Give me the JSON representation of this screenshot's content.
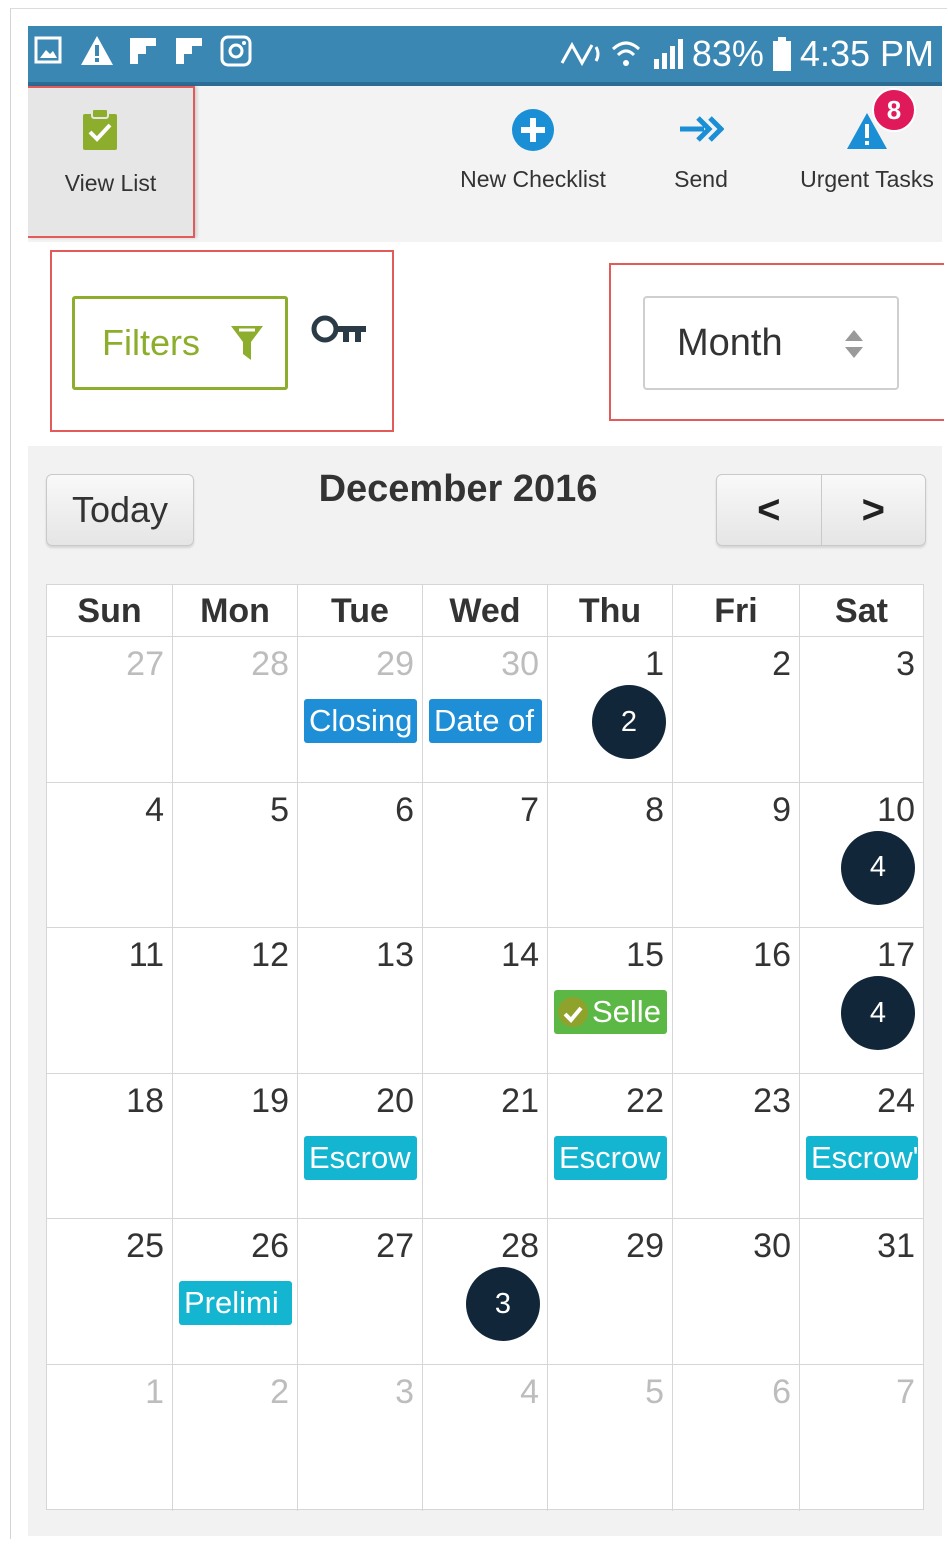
{
  "status_bar": {
    "battery": "83%",
    "time": "4:35 PM"
  },
  "toolbar": {
    "view_list": "View List",
    "new_checklist": "New Checklist",
    "send": "Send",
    "urgent_tasks": "Urgent Tasks",
    "urgent_count": "8"
  },
  "filters": {
    "label": "Filters"
  },
  "view_select": {
    "value": "Month"
  },
  "calendar": {
    "today_label": "Today",
    "title": "December 2016",
    "prev_label": "<",
    "next_label": ">",
    "weekdays": [
      "Sun",
      "Mon",
      "Tue",
      "Wed",
      "Thu",
      "Fri",
      "Sat"
    ],
    "weeks": [
      [
        {
          "day": "27",
          "other": true
        },
        {
          "day": "28",
          "other": true
        },
        {
          "day": "29",
          "other": true,
          "event": "Closing",
          "event_color": "blue"
        },
        {
          "day": "30",
          "other": true,
          "event": "Date of",
          "event_color": "blue"
        },
        {
          "day": "1",
          "count": "2"
        },
        {
          "day": "2"
        },
        {
          "day": "3"
        }
      ],
      [
        {
          "day": "4"
        },
        {
          "day": "5"
        },
        {
          "day": "6"
        },
        {
          "day": "7"
        },
        {
          "day": "8"
        },
        {
          "day": "9"
        },
        {
          "day": "10",
          "count": "4"
        }
      ],
      [
        {
          "day": "11"
        },
        {
          "day": "12"
        },
        {
          "day": "13"
        },
        {
          "day": "14"
        },
        {
          "day": "15",
          "event": "Selle",
          "event_color": "green",
          "completed": true
        },
        {
          "day": "16"
        },
        {
          "day": "17",
          "count": "4"
        }
      ],
      [
        {
          "day": "18"
        },
        {
          "day": "19"
        },
        {
          "day": "20",
          "event": "Escrow",
          "event_color": "cyan"
        },
        {
          "day": "21"
        },
        {
          "day": "22",
          "event": "Escrow",
          "event_color": "cyan"
        },
        {
          "day": "23"
        },
        {
          "day": "24",
          "event": "Escrow'",
          "event_color": "cyan"
        }
      ],
      [
        {
          "day": "25"
        },
        {
          "day": "26",
          "event": "Prelimi",
          "event_color": "cyan"
        },
        {
          "day": "27"
        },
        {
          "day": "28",
          "count": "3"
        },
        {
          "day": "29"
        },
        {
          "day": "30"
        },
        {
          "day": "31"
        }
      ],
      [
        {
          "day": "1",
          "other": true
        },
        {
          "day": "2",
          "other": true
        },
        {
          "day": "3",
          "other": true
        },
        {
          "day": "4",
          "other": true
        },
        {
          "day": "5",
          "other": true
        },
        {
          "day": "6",
          "other": true
        },
        {
          "day": "7",
          "other": true
        }
      ]
    ]
  },
  "colors": {
    "status_bar": "#3a87b4",
    "accent_green": "#8cae2c",
    "event_blue": "#1e8fd6",
    "event_cyan": "#14b5d1",
    "event_green": "#5cb845",
    "count_badge": "#12263a",
    "urgent_badge": "#e0195a",
    "highlight_border": "#e25a5a"
  }
}
